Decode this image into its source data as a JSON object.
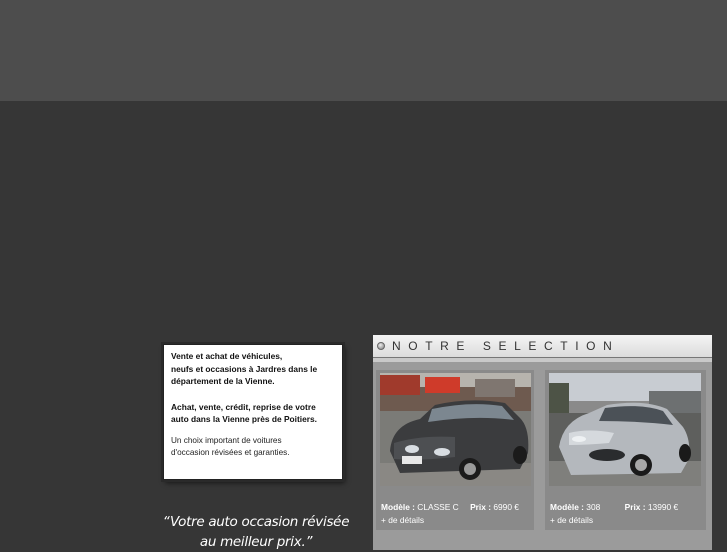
{
  "intro": {
    "line1": "Vente et achat de véhicules,",
    "line2": "neufs et occasions à Jardres dans le",
    "line3": "département de la Vienne.",
    "line4": "Achat, vente, crédit, reprise de votre",
    "line5": "auto dans la Vienne près de Poitiers.",
    "line6": "Un choix important de voitures",
    "line7": "d'occasion révisées et garanties."
  },
  "quote": {
    "line1": "“Votre auto occasion révisée",
    "line2": "au meilleur prix.”"
  },
  "selection": {
    "title": "NOTRE SELECTION",
    "cars": [
      {
        "model_label": "Modèle :",
        "model": "CLASSE C",
        "price_label": "Prix :",
        "price": "6990 €",
        "details": "+ de détails",
        "photo_icon": "silver-mercedes-classe-c-photo"
      },
      {
        "model_label": "Modèle :",
        "model": "308",
        "price_label": "Prix :",
        "price": "13990 €",
        "details": "+ de détails",
        "photo_icon": "silver-peugeot-308-photo"
      }
    ]
  },
  "colors": {
    "background": "#363636",
    "top_band": "#4d4d4d",
    "card": "#8a8a8a",
    "panel": "#9b9b9b"
  }
}
